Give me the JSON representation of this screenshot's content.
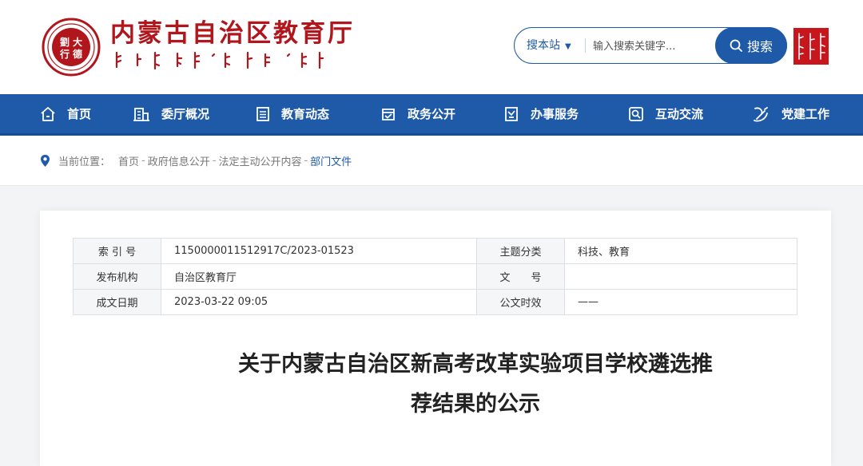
{
  "header": {
    "site_title": "内蒙古自治区教育厅",
    "emblem_text": [
      "大",
      "德",
      "劉",
      "行"
    ],
    "search": {
      "scope_label": "搜本站",
      "placeholder": "输入搜索关键字...",
      "button_label": "搜索"
    },
    "seal_text": "内蒙古"
  },
  "nav": {
    "items": [
      {
        "label": "首页",
        "icon": "home-icon"
      },
      {
        "label": "委厅概况",
        "icon": "building-icon"
      },
      {
        "label": "教育动态",
        "icon": "news-list-icon"
      },
      {
        "label": "政务公开",
        "icon": "inbox-check-icon"
      },
      {
        "label": "办事服务",
        "icon": "service-doc-icon"
      },
      {
        "label": "互动交流",
        "icon": "chat-icon"
      },
      {
        "label": "党建工作",
        "icon": "party-emblem-icon"
      }
    ]
  },
  "breadcrumb": {
    "label": "当前位置：",
    "items": [
      "首页",
      "政府信息公开",
      "法定主动公开内容"
    ],
    "separator": "-",
    "current": "部门文件"
  },
  "meta": {
    "rows": [
      {
        "k1": "索 引 号",
        "v1": "1150000011512917C/2023-01523",
        "k2": "主题分类",
        "v2": "科技、教育"
      },
      {
        "k1": "发布机构",
        "v1": "自治区教育厅",
        "k2": "文　　号",
        "v2": ""
      },
      {
        "k1": "成文日期",
        "v1": "2023-03-22 09:05",
        "k2": "公文时效",
        "v2": "——"
      }
    ]
  },
  "document": {
    "title_line1": "关于内蒙古自治区新高考改革实验项目学校遴选推",
    "title_line2": "荐结果的公示"
  },
  "colors": {
    "brand_blue": "#1f5aa8",
    "brand_red": "#b0161c",
    "page_bg": "#f3f4f6"
  }
}
